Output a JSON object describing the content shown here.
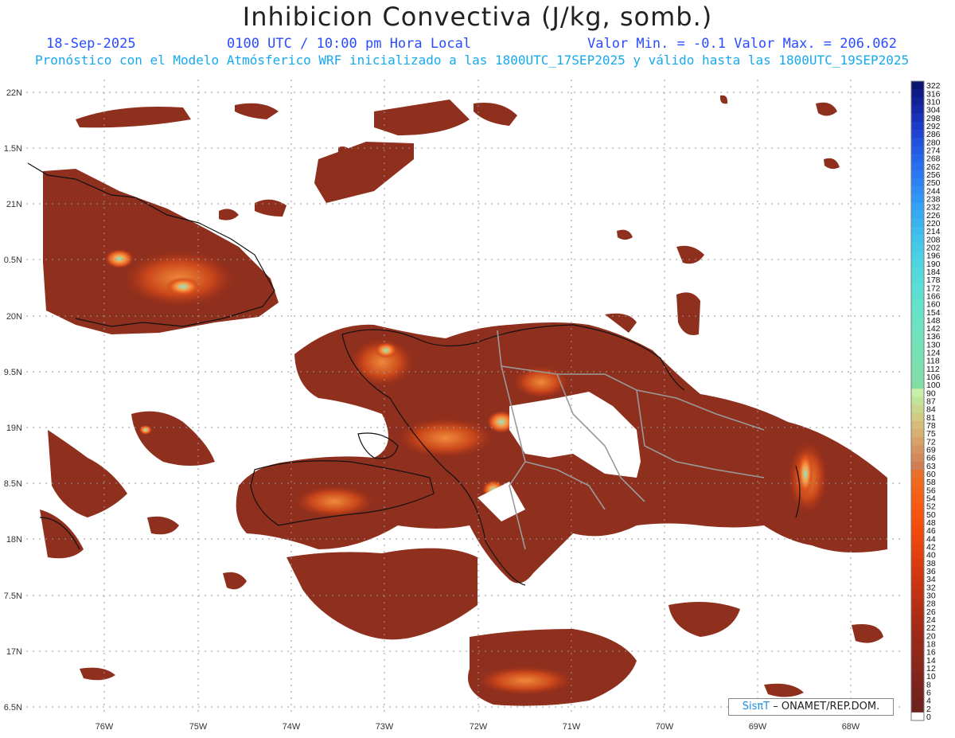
{
  "title": "Inhibicion Convectiva (J/kg, somb.)",
  "date": "18-Sep-2025",
  "time": "0100 UTC / 10:00 pm Hora Local",
  "minmax": "Valor Min. = -0.1  Valor Max. = 206.062",
  "subtitle": "Pronóstico con el Modelo Atmósferico WRF inicializado a las 1800UTC_17SEP2025 y válido hasta las  1800UTC_19SEP2025",
  "credit": {
    "logo": "SisπT",
    "org": "– ONAMET/REP.DOM."
  },
  "lat_labels": [
    "22N",
    "1.5N",
    "21N",
    "0.5N",
    "20N",
    "9.5N",
    "19N",
    "8.5N",
    "18N",
    "7.5N",
    "17N",
    "6.5N"
  ],
  "lon_labels": [
    "76W",
    "75W",
    "74W",
    "73W",
    "72W",
    "71W",
    "70W",
    "69W",
    "68W"
  ],
  "colorbar": {
    "labels": [
      "322",
      "316",
      "310",
      "304",
      "298",
      "292",
      "286",
      "280",
      "274",
      "268",
      "262",
      "256",
      "250",
      "244",
      "238",
      "232",
      "226",
      "220",
      "214",
      "208",
      "202",
      "196",
      "190",
      "184",
      "178",
      "172",
      "166",
      "160",
      "154",
      "148",
      "142",
      "136",
      "130",
      "124",
      "118",
      "112",
      "106",
      "100",
      "90",
      "87",
      "84",
      "81",
      "78",
      "75",
      "72",
      "69",
      "66",
      "63",
      "60",
      "58",
      "56",
      "54",
      "52",
      "50",
      "48",
      "46",
      "44",
      "42",
      "40",
      "38",
      "36",
      "34",
      "32",
      "30",
      "28",
      "26",
      "24",
      "22",
      "20",
      "18",
      "16",
      "14",
      "12",
      "10",
      "8",
      "6",
      "4",
      "2",
      "0"
    ],
    "colors": [
      "#0b1470",
      "#0f1a86",
      "#122196",
      "#1529a8",
      "#1833ba",
      "#1c3cc8",
      "#1f45d2",
      "#2150dc",
      "#235ae4",
      "#2565ea",
      "#286fef",
      "#2a79f2",
      "#2c83f4",
      "#2f8df5",
      "#3197f5",
      "#34a1f4",
      "#37aaf2",
      "#3ab3ef",
      "#3ebced",
      "#42c3ea",
      "#46c9e7",
      "#4acfe4",
      "#4ed4e1",
      "#52d8dd",
      "#56dbd9",
      "#5addd5",
      "#5edfd1",
      "#62e1cd",
      "#66e2c9",
      "#6ae3c5",
      "#6de3c1",
      "#70e3bd",
      "#73e2b9",
      "#76e1b5",
      "#79e0b1",
      "#7cdfad",
      "#7fdea9",
      "#82dda5",
      "#c8f0a8",
      "#c2e49a",
      "#cbd78e",
      "#d2cb83",
      "#d5bd79",
      "#d6b070",
      "#d6a268",
      "#d59562",
      "#d4895c",
      "#d27d56",
      "#e8702a",
      "#ee6a20",
      "#f2641a",
      "#f55e16",
      "#f65913",
      "#f55410",
      "#f3500e",
      "#f04b0d",
      "#ec470d",
      "#e7430d",
      "#e13f0e",
      "#db3c0f",
      "#d43910",
      "#cd3611",
      "#c63412",
      "#bf3213",
      "#b83014",
      "#b12e15",
      "#aa2d16",
      "#a32b17",
      "#9d2a18",
      "#972919",
      "#91281a",
      "#8b271b",
      "#86261c",
      "#81251d",
      "#7c241d",
      "#77241e",
      "#73231e",
      "#6f231f",
      "#ffffff"
    ]
  }
}
